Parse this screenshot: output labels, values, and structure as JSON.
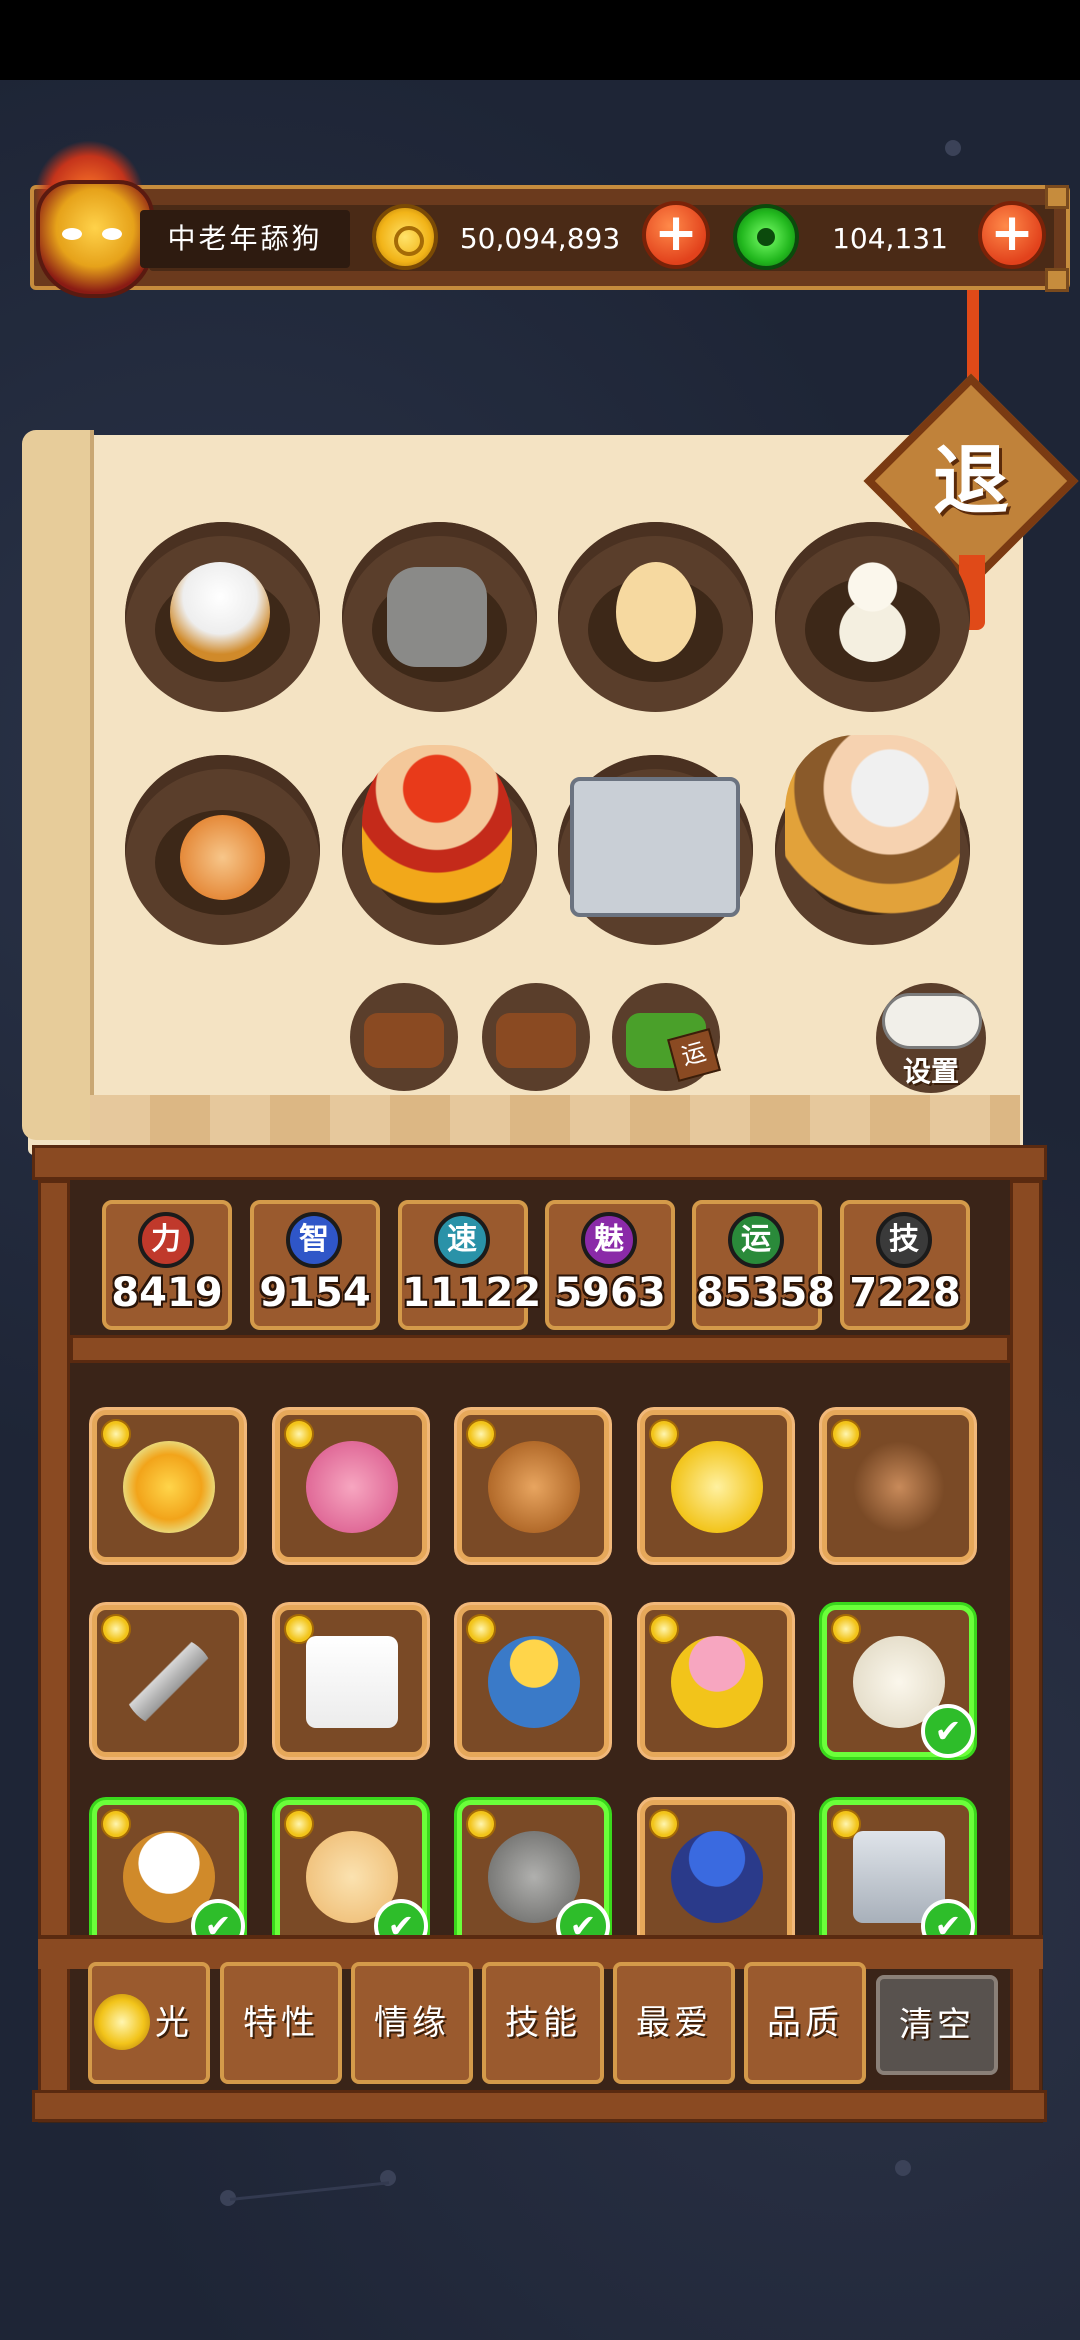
{
  "header": {
    "username": "中老年舔狗",
    "gold_amount": "50,094,893",
    "jade_amount": "104,131"
  },
  "exit_button": {
    "label": "退"
  },
  "settings_button": {
    "label": "设置"
  },
  "food_buttons": [
    {
      "name": "food-basket-1"
    },
    {
      "name": "food-basket-2"
    },
    {
      "name": "luck-mooncake",
      "label": "运"
    }
  ],
  "stats": [
    {
      "name": "力",
      "value": "8419",
      "color": "#c0392b"
    },
    {
      "name": "智",
      "value": "9154",
      "color": "#2f56c8"
    },
    {
      "name": "速",
      "value": "11122",
      "color": "#2a92a8"
    },
    {
      "name": "魅",
      "value": "5963",
      "color": "#8a2aa8"
    },
    {
      "name": "运",
      "value": "85358",
      "color": "#2a8a3a"
    },
    {
      "name": "技",
      "value": "7228",
      "color": "#3a3a3a"
    }
  ],
  "filters": [
    {
      "label": "光"
    },
    {
      "label": "特性"
    },
    {
      "label": "情缘"
    },
    {
      "label": "技能"
    },
    {
      "label": "最爱"
    },
    {
      "label": "品质"
    },
    {
      "label": "清空"
    }
  ],
  "items": [
    {
      "icon": "lotus-flower-icon",
      "selected": false
    },
    {
      "icon": "pink-bear-icon",
      "selected": false
    },
    {
      "icon": "wood-token-icon",
      "selected": false
    },
    {
      "icon": "star-capricorn-icon",
      "selected": false
    },
    {
      "icon": "acorn-fox-icon",
      "selected": false
    },
    {
      "icon": "sword-icon",
      "selected": false
    },
    {
      "icon": "playing-card-icon",
      "selected": false
    },
    {
      "icon": "blond-hero-icon",
      "selected": false
    },
    {
      "icon": "pink-girl-icon",
      "selected": false
    },
    {
      "icon": "snowman-icon",
      "selected": true
    },
    {
      "icon": "feather-pot-icon",
      "selected": true
    },
    {
      "icon": "chick-icon",
      "selected": true
    },
    {
      "icon": "rock-monkey-icon",
      "selected": true
    },
    {
      "icon": "blue-warrior-icon",
      "selected": false
    },
    {
      "icon": "fridge-girl-icon",
      "selected": true
    }
  ],
  "slots": [
    {
      "icon": "feather-pot-icon"
    },
    {
      "icon": "rock-monkey-icon"
    },
    {
      "icon": "chick-icon"
    },
    {
      "icon": "snowman-icon"
    },
    {
      "icon": "pig-pot-icon"
    },
    {
      "icon": "red-hair-hero-icon"
    },
    {
      "icon": "fridge-girl-icon"
    },
    {
      "icon": "fox-girl-icon"
    }
  ]
}
